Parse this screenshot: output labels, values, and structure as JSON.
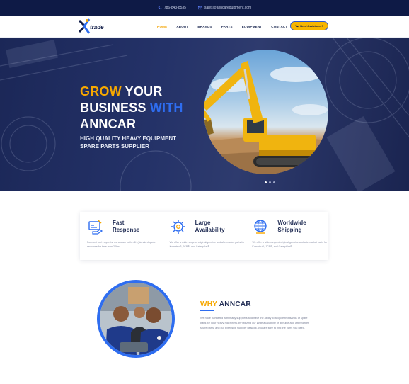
{
  "topbar": {
    "phone": "786-843-8535",
    "email": "sales@anncarequipment.com"
  },
  "header": {
    "logo_text": "trade",
    "nav": [
      "HOME",
      "ABOUT",
      "BRANDS",
      "PARTS",
      "EQUIPMENT",
      "CONTACT"
    ],
    "active_nav": "HOME",
    "cta_label": "Need Assistance?"
  },
  "hero": {
    "title_line1_accent": "GROW",
    "title_line1_rest": " YOUR",
    "title_line2_white": "BUSINESS ",
    "title_line2_blue": "WITH",
    "title_line3": "ANNCAR",
    "subtitle_line1": "HIGH QUALITY HEAVY EQUIPMENT",
    "subtitle_line2": "SPARE PARTS SUPPLIER",
    "slides": 3,
    "active_slide": 1
  },
  "features": [
    {
      "icon": "fast-response-icon",
      "title_line1": "Fast",
      "title_line2": "Response",
      "desc": "For most part requests, we answer within 1h (standard quote response for time from 24hrs)."
    },
    {
      "icon": "gear-availability-icon",
      "title_line1": "Large",
      "title_line2": "Availability",
      "desc": "We offer a wide range of original/genuine and aftermarket parts for Komatsu®, JCB®, and Caterpillar®."
    },
    {
      "icon": "globe-shipping-icon",
      "title_line1": "Worldwide",
      "title_line2": "Shipping",
      "desc": "We offer a wide range of original/genuine and aftermarket parts for Komatsu®, JCB®, and Caterpillar®..."
    }
  ],
  "why": {
    "title_accent": "WHY",
    "title_rest": " ANNCAR",
    "text": "We have partnered with many suppliers and have the ability to acquire thousands of spare parts for your heavy machinery. By utilizing our large availability of genuine and aftermarket spare parts, and our extensive supplier network, you are sure to find the parts you need."
  },
  "colors": {
    "navy": "#0e1a46",
    "accent_yellow": "#f7a800",
    "accent_blue": "#2e6df0"
  }
}
